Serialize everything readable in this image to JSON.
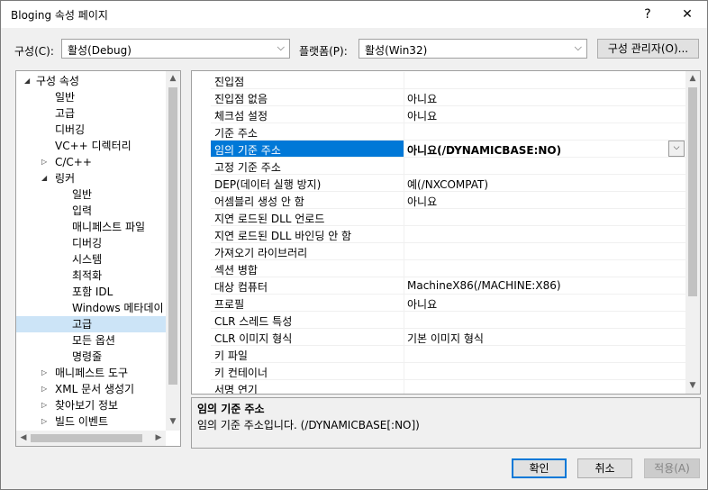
{
  "window": {
    "title": "Bloging 속성 페이지",
    "help": "?",
    "close": "✕"
  },
  "toolbar": {
    "config_label": "구성(C):",
    "config_value": "활성(Debug)",
    "platform_label": "플랫폼(P):",
    "platform_value": "활성(Win32)",
    "config_manager": "구성 관리자(O)..."
  },
  "tree": {
    "items": [
      {
        "label": "구성 속성",
        "expander": "◢"
      },
      {
        "label": "일반"
      },
      {
        "label": "고급"
      },
      {
        "label": "디버깅"
      },
      {
        "label": "VC++ 디렉터리"
      },
      {
        "label": "C/C++",
        "expander": "▷"
      },
      {
        "label": "링커",
        "expander": "◢"
      },
      {
        "label": "일반"
      },
      {
        "label": "입력"
      },
      {
        "label": "매니페스트 파일"
      },
      {
        "label": "디버깅"
      },
      {
        "label": "시스템"
      },
      {
        "label": "최적화"
      },
      {
        "label": "포함 IDL"
      },
      {
        "label": "Windows 메타데이"
      },
      {
        "label": "고급"
      },
      {
        "label": "모든 옵션"
      },
      {
        "label": "명령줄"
      },
      {
        "label": "매니페스트 도구",
        "expander": "▷"
      },
      {
        "label": "XML 문서 생성기",
        "expander": "▷"
      },
      {
        "label": "찾아보기 정보",
        "expander": "▷"
      },
      {
        "label": "빌드 이벤트",
        "expander": "▷"
      }
    ]
  },
  "grid": {
    "rows": [
      {
        "name": "진입점",
        "value": ""
      },
      {
        "name": "진입점 없음",
        "value": "아니요"
      },
      {
        "name": "체크섬 설정",
        "value": "아니요"
      },
      {
        "name": "기준 주소",
        "value": ""
      },
      {
        "name": "임의 기준 주소",
        "value": "아니요(/DYNAMICBASE:NO)"
      },
      {
        "name": "고정 기준 주소",
        "value": ""
      },
      {
        "name": "DEP(데이터 실행 방지)",
        "value": "예(/NXCOMPAT)"
      },
      {
        "name": "어셈블리 생성 안 함",
        "value": "아니요"
      },
      {
        "name": "지연 로드된 DLL 언로드",
        "value": ""
      },
      {
        "name": "지연 로드된 DLL 바인딩 안 함",
        "value": ""
      },
      {
        "name": "가져오기 라이브러리",
        "value": ""
      },
      {
        "name": "섹션 병합",
        "value": ""
      },
      {
        "name": "대상 컴퓨터",
        "value": "MachineX86(/MACHINE:X86)"
      },
      {
        "name": "프로필",
        "value": "아니요"
      },
      {
        "name": "CLR 스레드 특성",
        "value": ""
      },
      {
        "name": "CLR 이미지 형식",
        "value": "기본 이미지 형식"
      },
      {
        "name": "키 파일",
        "value": ""
      },
      {
        "name": "키 컨테이너",
        "value": ""
      },
      {
        "name": "서명 연기",
        "value": ""
      }
    ]
  },
  "description": {
    "title": "임의 기준 주소",
    "text": "임의 기준 주소입니다. (/DYNAMICBASE[:NO])"
  },
  "buttons": {
    "ok": "확인",
    "cancel": "취소",
    "apply": "적용(A)"
  }
}
